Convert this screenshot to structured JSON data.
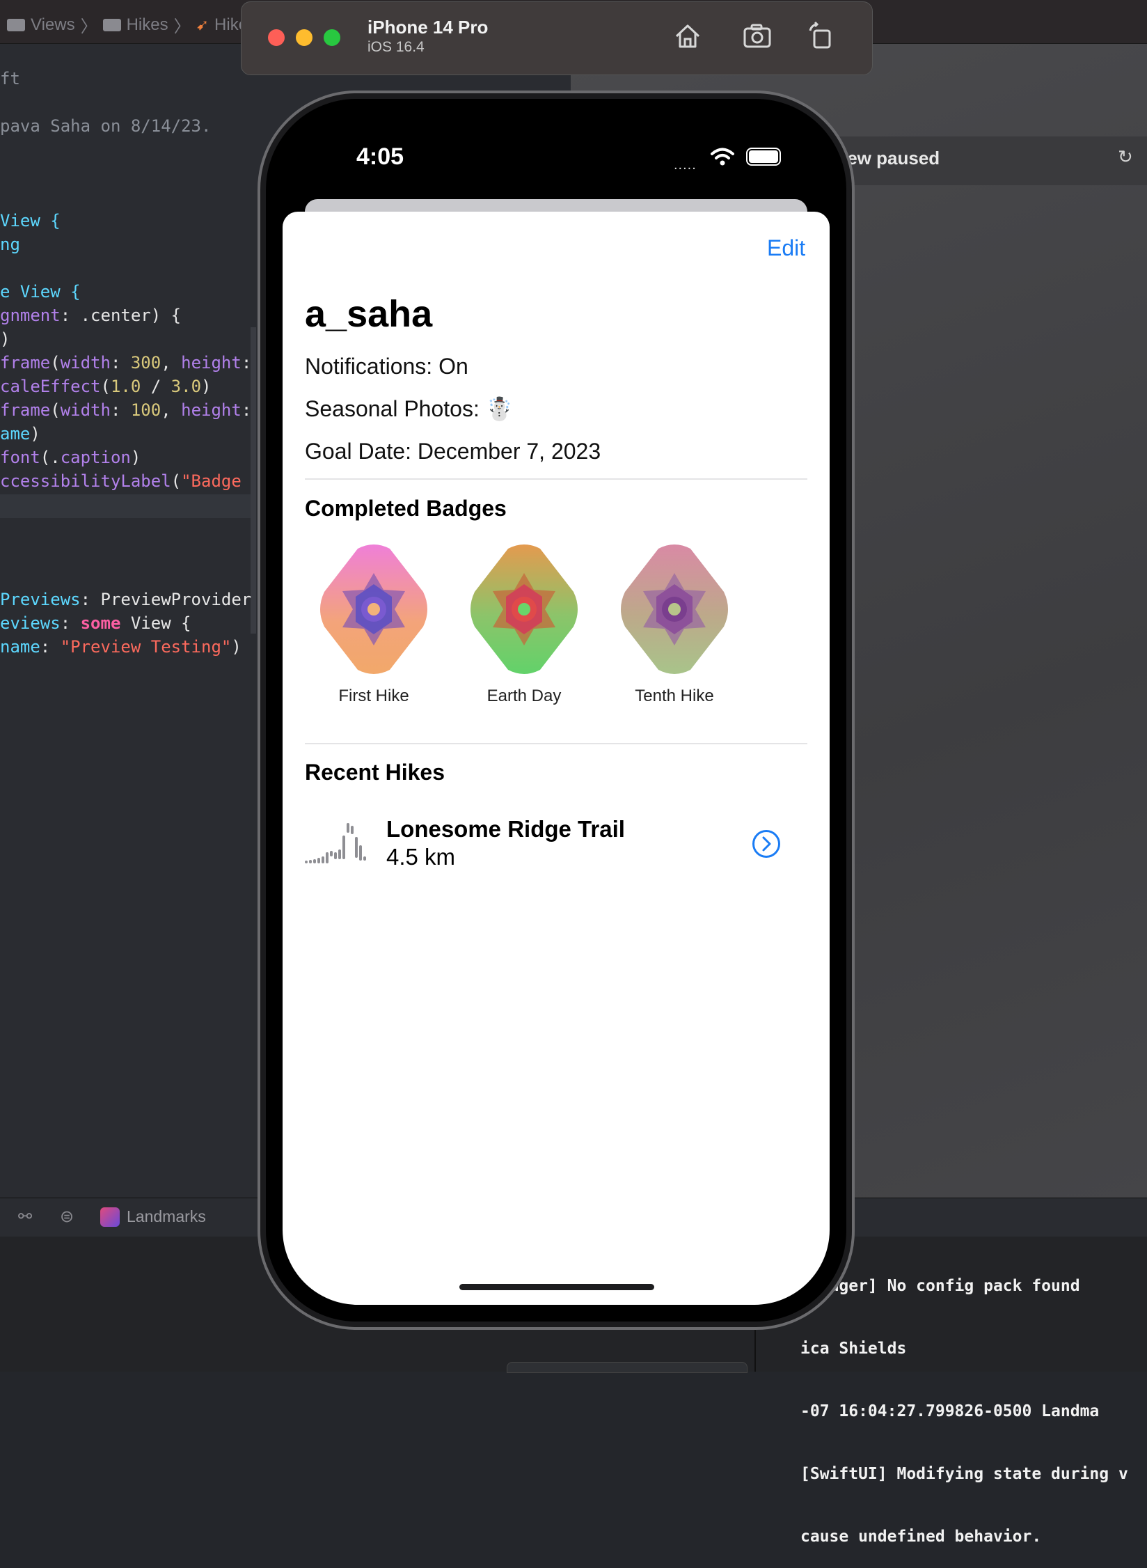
{
  "xcode": {
    "breadcrumb": [
      "Views",
      "Hikes",
      "Hike"
    ],
    "code_lines": [
      {
        "segments": [
          [
            "ft",
            "cmt"
          ]
        ]
      },
      {
        "segments": [
          [
            "",
            ""
          ]
        ]
      },
      {
        "segments": [
          [
            "pava Saha on 8/14/23.",
            "cmt"
          ]
        ]
      },
      {
        "segments": [
          [
            "",
            ""
          ]
        ]
      },
      {
        "segments": [
          [
            "",
            ""
          ]
        ]
      },
      {
        "segments": [
          [
            "",
            ""
          ]
        ]
      },
      {
        "segments": [
          [
            "View {",
            "typ"
          ]
        ]
      },
      {
        "segments": [
          [
            "ng",
            "typ"
          ]
        ]
      },
      {
        "segments": [
          [
            "",
            ""
          ]
        ]
      },
      {
        "segments": [
          [
            "e View {",
            "typ"
          ]
        ]
      },
      {
        "segments": [
          [
            "gnment",
            "fn"
          ],
          [
            ": .center) {",
            ""
          ]
        ]
      },
      {
        "segments": [
          [
            ")",
            ""
          ]
        ]
      },
      {
        "segments": [
          [
            "frame",
            "fn"
          ],
          [
            "(",
            ""
          ],
          [
            "width",
            "fn"
          ],
          [
            ": ",
            ""
          ],
          [
            "300",
            "num"
          ],
          [
            ", ",
            ""
          ],
          [
            "height",
            "fn"
          ],
          [
            ":",
            ""
          ]
        ]
      },
      {
        "segments": [
          [
            "caleEffect",
            "fn"
          ],
          [
            "(",
            ""
          ],
          [
            "1.0",
            "num"
          ],
          [
            " / ",
            ""
          ],
          [
            "3.0",
            "num"
          ],
          [
            ")",
            ""
          ]
        ]
      },
      {
        "segments": [
          [
            "frame",
            "fn"
          ],
          [
            "(",
            ""
          ],
          [
            "width",
            "fn"
          ],
          [
            ": ",
            ""
          ],
          [
            "100",
            "num"
          ],
          [
            ", ",
            ""
          ],
          [
            "height",
            "fn"
          ],
          [
            ":",
            ""
          ]
        ]
      },
      {
        "segments": [
          [
            "ame",
            "typ"
          ],
          [
            ")",
            ""
          ]
        ]
      },
      {
        "segments": [
          [
            "font",
            "fn"
          ],
          [
            "(.",
            ""
          ],
          [
            "caption",
            "fn"
          ],
          [
            ")",
            ""
          ]
        ]
      },
      {
        "segments": [
          [
            "ccessibilityLabel",
            "fn"
          ],
          [
            "(",
            ""
          ],
          [
            "\"Badge",
            "str"
          ]
        ]
      },
      {
        "segments": [
          [
            "",
            ""
          ]
        ]
      },
      {
        "segments": [
          [
            "",
            ""
          ]
        ]
      },
      {
        "segments": [
          [
            "",
            ""
          ]
        ]
      },
      {
        "segments": [
          [
            "",
            ""
          ]
        ]
      },
      {
        "segments": [
          [
            "Previews",
            "typ"
          ],
          [
            ": PreviewProvider",
            ""
          ]
        ]
      },
      {
        "segments": [
          [
            "eviews",
            "typ"
          ],
          [
            ": ",
            ""
          ],
          [
            "some",
            "kw"
          ],
          [
            " View {",
            ""
          ]
        ]
      },
      {
        "segments": [
          [
            "name",
            "typ"
          ],
          [
            ": ",
            ""
          ],
          [
            "\"Preview Testing\"",
            "str"
          ],
          [
            ")",
            ""
          ]
        ]
      }
    ],
    "canvas_status": "iew paused",
    "scheme": "Landmarks",
    "console_lines": [
      "Manager] No config pack found",
      "ica Shields",
      "-07 16:04:27.799826-0500 Landma",
      "[SwiftUI] Modifying state during v",
      "cause undefined behavior."
    ]
  },
  "simulator": {
    "device": "iPhone 14 Pro",
    "os": "iOS 16.4"
  },
  "status_bar": {
    "time": "4:05",
    "signal": "....."
  },
  "profile": {
    "edit_label": "Edit",
    "username": "a_saha",
    "notifications": "Notifications: On",
    "seasonal_label": "Seasonal Photos:",
    "seasonal_emoji": "☃️",
    "goal_date": "Goal Date: December 7, 2023",
    "badges_title": "Completed Badges",
    "badges": [
      {
        "label": "First Hike"
      },
      {
        "label": "Earth Day"
      },
      {
        "label": "Tenth Hike"
      }
    ],
    "recent_title": "Recent Hikes",
    "hike": {
      "name": "Lonesome Ridge Trail",
      "distance": "4.5 km"
    }
  },
  "colors": {
    "accent": "#1a7cf5"
  }
}
